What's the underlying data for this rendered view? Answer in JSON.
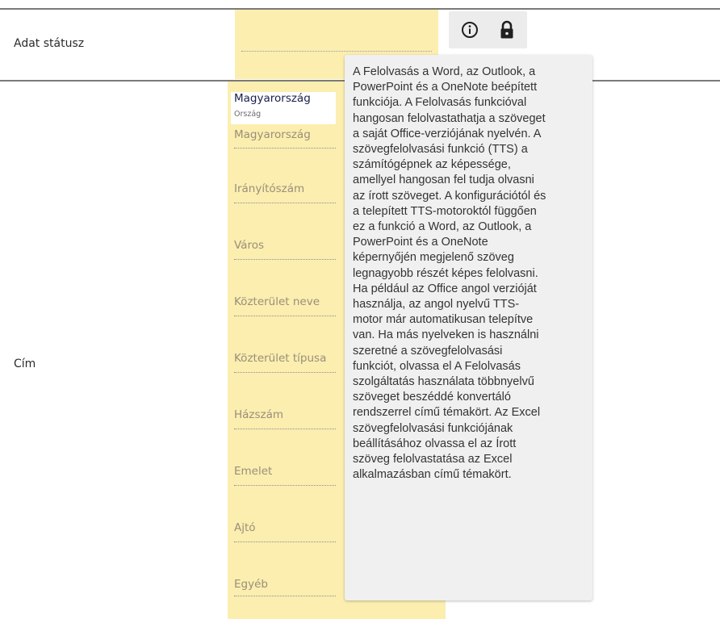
{
  "rows": {
    "status_label": "Adat státusz",
    "address_label": "Cím"
  },
  "icons": {
    "info": "info-icon",
    "lock": "lock-icon"
  },
  "address": {
    "suggestion": {
      "value": "Magyarország",
      "caption": "Ország"
    },
    "fields": [
      {
        "placeholder": "Magyarország"
      },
      {
        "placeholder": "Irányítószám"
      },
      {
        "placeholder": "Város"
      },
      {
        "placeholder": "Közterület neve"
      },
      {
        "placeholder": "Közterület típusa"
      },
      {
        "placeholder": "Házszám"
      },
      {
        "placeholder": "Emelet"
      },
      {
        "placeholder": "Ajtó"
      },
      {
        "placeholder": "Egyéb"
      }
    ]
  },
  "tooltip": {
    "text": "A Felolvasás a Word, az Outlook, a\nPowerPoint és a OneNote beépített\nfunkciója. A Felolvasás funkcióval\nhangosan felolvastathatja a szöveget\na saját Office-verziójának nyelvén.  A\nszövegfelolvasási funkció (TTS) a\nszámítógépnek az képessége,\namellyel hangosan fel tudja olvasni\naz írott szöveget. A konfigurációtól és\na telepített TTS-motoroktól függően\nez a funkció a Word, az Outlook, a\nPowerPoint és a OneNote\nképernyőjén megjelenő szöveg\nlegnagyobb részét képes felolvasni.\nHa például az Office angol verzióját\nhasználja, az angol nyelvű TTS-\nmotor már automatikusan telepítve\nvan. Ha más nyelveken is használni\nszeretné a szövegfelolvasási\nfunkciót, olvassa el A Felolvasás\nszolgáltatás használata többnyelvű\nszöveget beszéddé konvertáló\nrendszerrel című témakört.  Az Excel\nszövegfelolvasási funkciójának\nbeállításához olvassa el az Írott\nszöveg felolvastatása az Excel\nalkalmazásban című témakört."
  },
  "colors": {
    "field_background": "#fbeeaf",
    "tooltip_background": "#f0f0f0",
    "rule": "#7a7a7a"
  }
}
